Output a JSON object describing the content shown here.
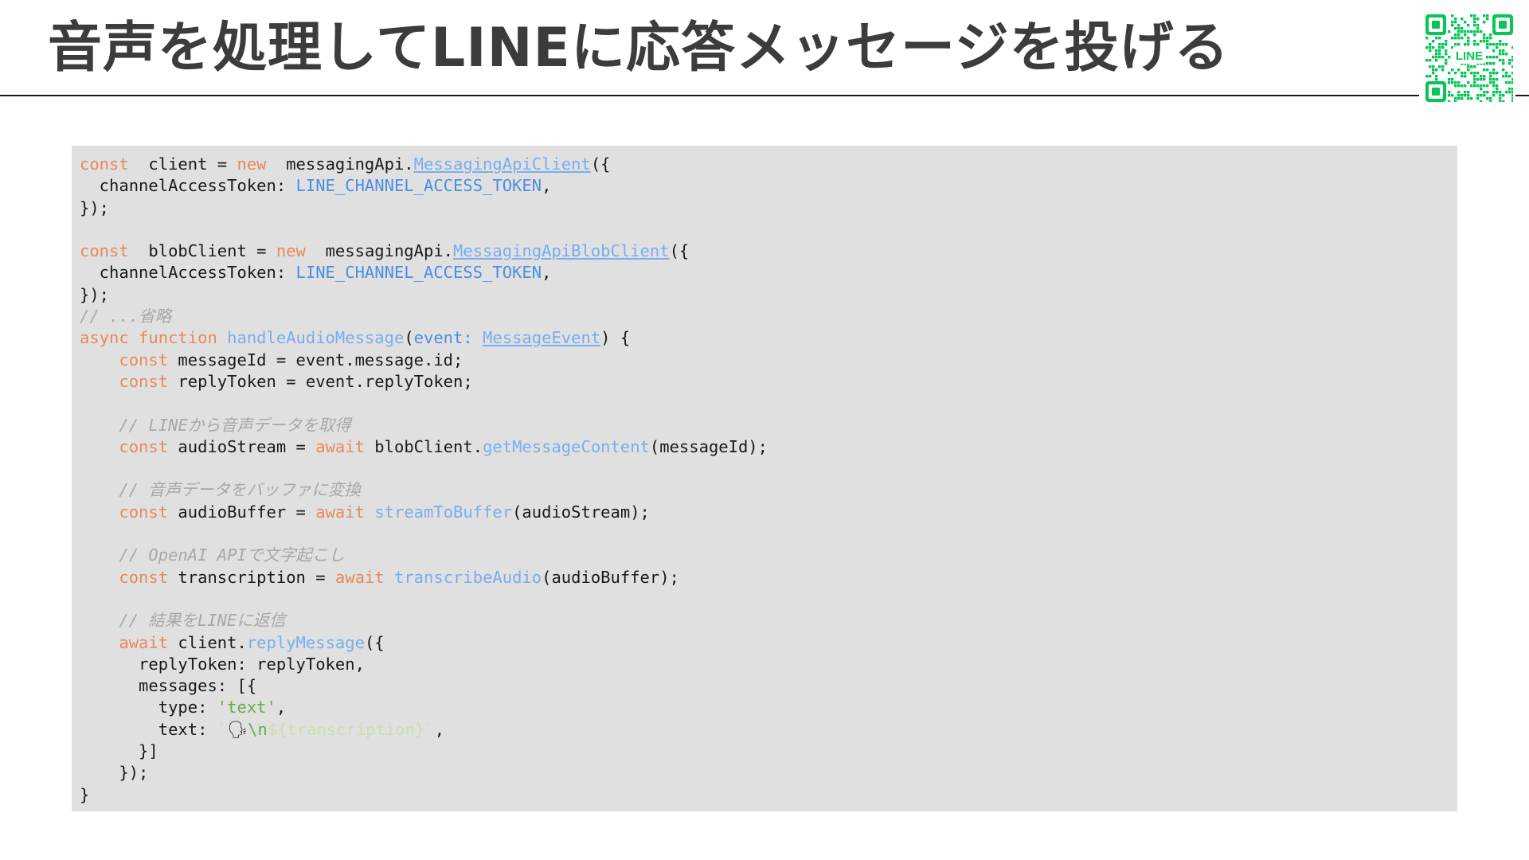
{
  "slide": {
    "title": "音声を処理してLINEに応答メッセージを投げる",
    "qr_label": "LINE",
    "accent": "#06c755"
  },
  "code": {
    "language": "typescript",
    "lines": [
      [
        [
          "kw",
          "const"
        ],
        [
          "",
          "  client = "
        ],
        [
          "kw",
          "new"
        ],
        [
          "",
          "  messagingApi."
        ],
        [
          "cls",
          "MessagingApiClient"
        ],
        [
          "",
          "({"
        ]
      ],
      [
        [
          "",
          "  channelAccessToken: "
        ],
        [
          "const",
          "LINE_CHANNEL_ACCESS_TOKEN"
        ],
        [
          "",
          ","
        ]
      ],
      [
        [
          "",
          "});"
        ]
      ],
      [],
      [
        [
          "kw",
          "const"
        ],
        [
          "",
          "  blobClient = "
        ],
        [
          "kw",
          "new"
        ],
        [
          "",
          "  messagingApi."
        ],
        [
          "cls",
          "MessagingApiBlobClient"
        ],
        [
          "",
          "({"
        ]
      ],
      [
        [
          "",
          "  channelAccessToken: "
        ],
        [
          "const",
          "LINE_CHANNEL_ACCESS_TOKEN"
        ],
        [
          "",
          ","
        ]
      ],
      [
        [
          "",
          "});"
        ]
      ],
      [
        [
          "cm",
          "// ...省略"
        ]
      ],
      [
        [
          "kw",
          "async function"
        ],
        [
          "",
          " "
        ],
        [
          "fn",
          "handleAudioMessage"
        ],
        [
          "",
          "("
        ],
        [
          "param",
          "event: "
        ],
        [
          "cls",
          "MessageEvent"
        ],
        [
          "",
          ") {"
        ]
      ],
      [
        [
          "",
          "    "
        ],
        [
          "kw",
          "const"
        ],
        [
          "",
          " messageId = event.message.id;"
        ]
      ],
      [
        [
          "",
          "    "
        ],
        [
          "kw",
          "const"
        ],
        [
          "",
          " replyToken = event.replyToken;"
        ]
      ],
      [],
      [
        [
          "",
          "    "
        ],
        [
          "cm",
          "// LINEから音声データを取得"
        ]
      ],
      [
        [
          "",
          "    "
        ],
        [
          "kw",
          "const"
        ],
        [
          "",
          " audioStream = "
        ],
        [
          "kw",
          "await"
        ],
        [
          "",
          " blobClient."
        ],
        [
          "fn",
          "getMessageContent"
        ],
        [
          "",
          "(messageId);"
        ]
      ],
      [],
      [
        [
          "",
          "    "
        ],
        [
          "cm",
          "// 音声データをバッファに変換"
        ]
      ],
      [
        [
          "",
          "    "
        ],
        [
          "kw",
          "const"
        ],
        [
          "",
          " audioBuffer = "
        ],
        [
          "kw",
          "await"
        ],
        [
          "",
          " "
        ],
        [
          "fn",
          "streamToBuffer"
        ],
        [
          "",
          "(audioStream);"
        ]
      ],
      [],
      [
        [
          "",
          "    "
        ],
        [
          "cm",
          "// OpenAI APIで文字起こし"
        ]
      ],
      [
        [
          "",
          "    "
        ],
        [
          "kw",
          "const"
        ],
        [
          "",
          " transcription = "
        ],
        [
          "kw",
          "await"
        ],
        [
          "",
          " "
        ],
        [
          "fn",
          "transcribeAudio"
        ],
        [
          "",
          "(audioBuffer);"
        ]
      ],
      [],
      [
        [
          "",
          "    "
        ],
        [
          "cm",
          "// 結果をLINEに返信"
        ]
      ],
      [
        [
          "",
          "    "
        ],
        [
          "kw",
          "await"
        ],
        [
          "",
          " client."
        ],
        [
          "fn",
          "replyMessage"
        ],
        [
          "",
          "({"
        ]
      ],
      [
        [
          "",
          "      replyToken: replyToken,"
        ]
      ],
      [
        [
          "",
          "      messages: [{"
        ]
      ],
      [
        [
          "",
          "        type: "
        ],
        [
          "str",
          "'text'"
        ],
        [
          "",
          ","
        ]
      ],
      [
        [
          "",
          "        text: "
        ],
        [
          "tmpl",
          "`"
        ],
        [
          "",
          "🗣"
        ],
        [
          "esc",
          "\\n"
        ],
        [
          "tmpl",
          "${transcription}`"
        ],
        [
          "",
          ","
        ]
      ],
      [
        [
          "",
          "      }]"
        ]
      ],
      [
        [
          "",
          "    });"
        ]
      ],
      [
        [
          "",
          "}"
        ]
      ]
    ]
  }
}
